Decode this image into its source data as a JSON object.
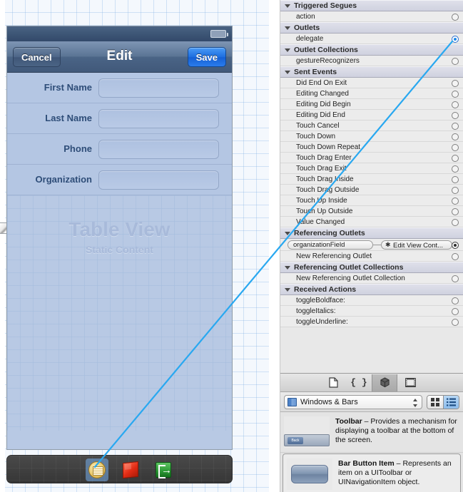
{
  "canvas": {
    "device": {
      "statusbar": {
        "battery_icon": "battery-icon"
      },
      "navbar": {
        "cancel_label": "Cancel",
        "title": "Edit",
        "save_label": "Save"
      },
      "form_rows": [
        {
          "label": "First Name",
          "value": "",
          "placeholder": ""
        },
        {
          "label": "Last Name",
          "value": "",
          "placeholder": ""
        },
        {
          "label": "Phone",
          "value": "",
          "placeholder": ""
        },
        {
          "label": "Organization",
          "value": "",
          "placeholder": ""
        }
      ],
      "tableview": {
        "title": "Table View",
        "subtitle": "Static Content"
      }
    },
    "dock": {
      "items": [
        {
          "name": "view-controller-icon",
          "selected": true
        },
        {
          "name": "first-responder-icon",
          "selected": false
        },
        {
          "name": "exit-icon",
          "selected": false
        }
      ]
    }
  },
  "inspector": {
    "sections": [
      {
        "title": "Triggered Segues",
        "rows": [
          {
            "label": "action",
            "state": "empty"
          }
        ]
      },
      {
        "title": "Outlets",
        "rows": [
          {
            "label": "delegate",
            "state": "connected"
          }
        ]
      },
      {
        "title": "Outlet Collections",
        "rows": [
          {
            "label": "gestureRecognizers",
            "state": "empty"
          }
        ]
      },
      {
        "title": "Sent Events",
        "rows": [
          {
            "label": "Did End On Exit",
            "state": "empty"
          },
          {
            "label": "Editing Changed",
            "state": "empty"
          },
          {
            "label": "Editing Did Begin",
            "state": "empty"
          },
          {
            "label": "Editing Did End",
            "state": "empty"
          },
          {
            "label": "Touch Cancel",
            "state": "empty"
          },
          {
            "label": "Touch Down",
            "state": "empty"
          },
          {
            "label": "Touch Down Repeat",
            "state": "empty"
          },
          {
            "label": "Touch Drag Enter",
            "state": "empty"
          },
          {
            "label": "Touch Drag Exit",
            "state": "empty"
          },
          {
            "label": "Touch Drag Inside",
            "state": "empty"
          },
          {
            "label": "Touch Drag Outside",
            "state": "empty"
          },
          {
            "label": "Touch Up Inside",
            "state": "empty"
          },
          {
            "label": "Touch Up Outside",
            "state": "empty"
          },
          {
            "label": "Value Changed",
            "state": "empty"
          }
        ]
      },
      {
        "title": "Referencing Outlets",
        "pill_row": {
          "source": "organizationField",
          "target_star": "✱",
          "target": "Edit View Cont...",
          "state": "filled"
        },
        "rows": [
          {
            "label": "New Referencing Outlet",
            "state": "empty"
          }
        ]
      },
      {
        "title": "Referencing Outlet Collections",
        "rows": [
          {
            "label": "New Referencing Outlet Collection",
            "state": "empty"
          }
        ]
      },
      {
        "title": "Received Actions",
        "rows": [
          {
            "label": "toggleBoldface:",
            "state": "empty"
          },
          {
            "label": "toggleItalics:",
            "state": "empty"
          },
          {
            "label": "toggleUnderline:",
            "state": "empty"
          }
        ]
      }
    ]
  },
  "library": {
    "tabs": [
      {
        "name": "file-template-library-icon",
        "glyph": "🗋",
        "selected": false
      },
      {
        "name": "code-snippet-library-icon",
        "glyph": "{ }",
        "selected": false
      },
      {
        "name": "object-library-icon",
        "glyph": "box",
        "selected": true
      },
      {
        "name": "media-library-icon",
        "glyph": "film",
        "selected": false
      }
    ],
    "filter": {
      "selected_option": "Windows & Bars",
      "options": [
        "Windows & Bars"
      ],
      "icon": "library-book-icon"
    },
    "view_modes": [
      {
        "name": "grid-view-button",
        "selected": false
      },
      {
        "name": "list-view-button",
        "selected": true
      }
    ],
    "items": [
      {
        "title": "Toolbar",
        "separator": " – ",
        "description": "Provides a mechanism for displaying a toolbar at the bottom of the screen.",
        "selected": false
      },
      {
        "title": "Bar Button Item",
        "separator": " – ",
        "description": "Represents an item on a UIToolbar or UINavigationItem object.",
        "selected": true
      }
    ]
  },
  "colors": {
    "connection_line": "#29a8f0",
    "save_button": "#1d6ee0",
    "selection_highlight": "#78afeb",
    "canvas_grid": "#78aae1"
  }
}
